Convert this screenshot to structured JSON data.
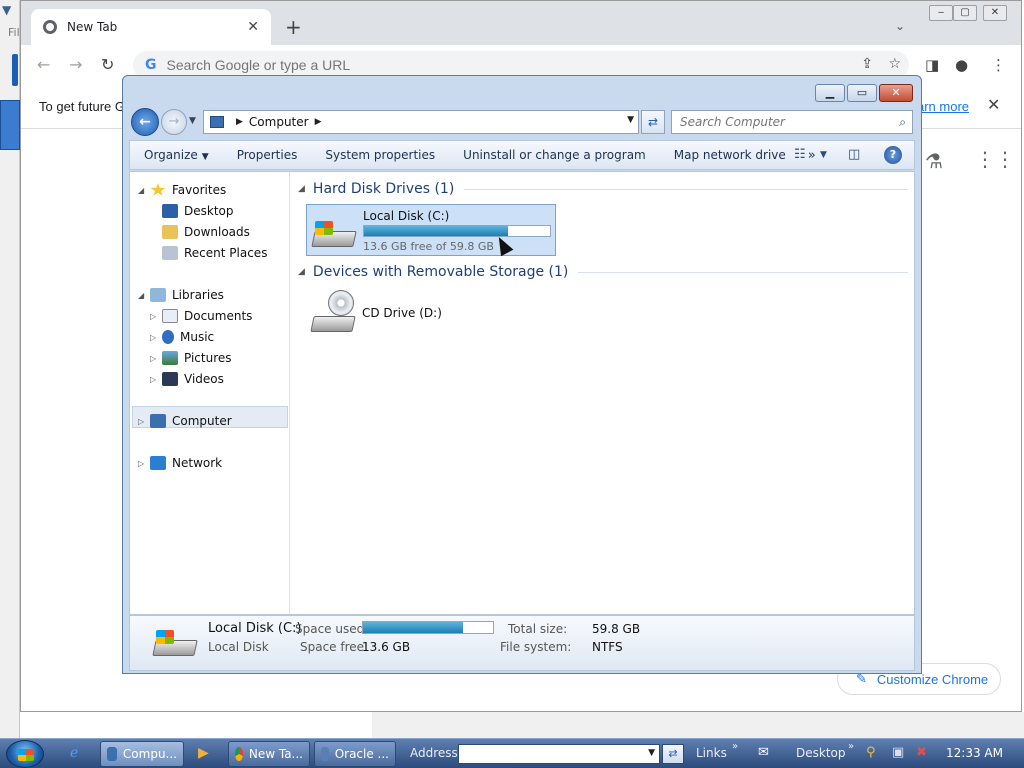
{
  "background": {
    "vbox_letters": "Fil"
  },
  "chrome": {
    "tab_title": "New Tab",
    "tab_close": "✕",
    "new_tab": "+",
    "omnibox_placeholder": "Search Google or type a URL",
    "infobar_text": "To get future G",
    "infobar_link": "arn more",
    "customize_label": "Customize Chrome"
  },
  "explorer": {
    "breadcrumb": "Computer",
    "search_placeholder": "Search Computer",
    "commands": [
      "Organize",
      "Properties",
      "System properties",
      "Uninstall or change a program",
      "Map network drive"
    ],
    "nav": {
      "favorites": "Favorites",
      "desktop": "Desktop",
      "downloads": "Downloads",
      "recent": "Recent Places",
      "libraries": "Libraries",
      "documents": "Documents",
      "music": "Music",
      "pictures": "Pictures",
      "videos": "Videos",
      "computer": "Computer",
      "network": "Network"
    },
    "groups": {
      "hdd": "Hard Disk Drives (1)",
      "removable": "Devices with Removable Storage (1)"
    },
    "drive_c": {
      "name": "Local Disk (C:)",
      "free_text": "13.6 GB free of 59.8 GB",
      "used_fraction": 0.773
    },
    "drive_d": {
      "name": "CD Drive (D:)"
    },
    "details": {
      "name": "Local Disk (C:)",
      "type": "Local Disk",
      "space_used_label": "Space used:",
      "space_free_label": "Space free:",
      "space_free": "13.6 GB",
      "total_label": "Total size:",
      "total": "59.8 GB",
      "fs_label": "File system:",
      "fs": "NTFS"
    }
  },
  "taskbar": {
    "buttons": [
      "Compu...",
      "New Ta...",
      "Oracle ..."
    ],
    "address_label": "Address",
    "links_label": "Links",
    "desktop_label": "Desktop",
    "clock": "12:33 AM"
  },
  "colors": {
    "accent": "#1a73e8",
    "explorer_frame": "#c9d9ee",
    "taskbar": "#2c4b7c"
  }
}
